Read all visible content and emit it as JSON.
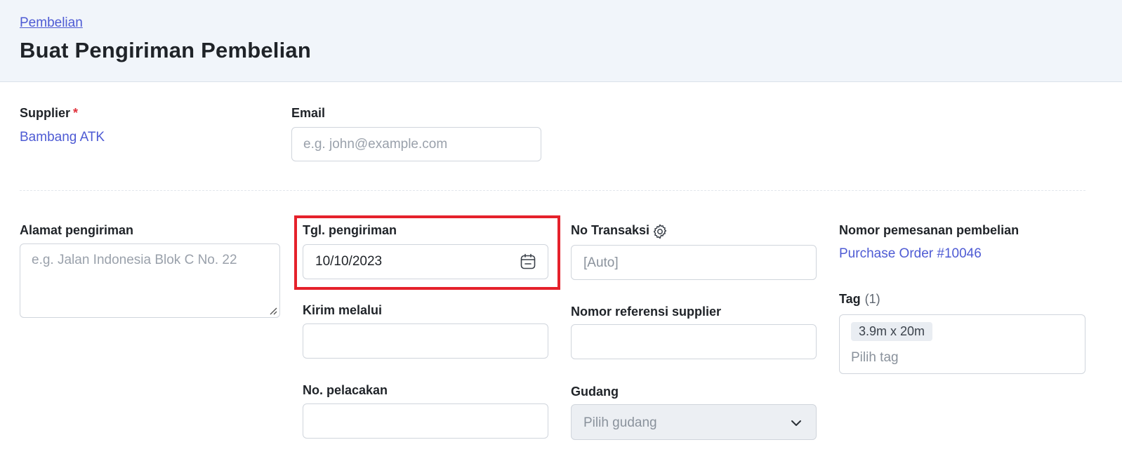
{
  "header": {
    "breadcrumb": "Pembelian",
    "title": "Buat Pengiriman Pembelian"
  },
  "supplier": {
    "label": "Supplier",
    "required_mark": "*",
    "value": "Bambang ATK"
  },
  "email": {
    "label": "Email",
    "placeholder": "e.g. john@example.com",
    "value": ""
  },
  "shipping_address": {
    "label": "Alamat pengiriman",
    "placeholder": "e.g. Jalan Indonesia Blok C No. 22",
    "value": ""
  },
  "shipping_date": {
    "label": "Tgl. pengiriman",
    "value": "10/10/2023",
    "icon": "calendar-icon"
  },
  "transaction_no": {
    "label": "No Transaksi",
    "icon": "gear-icon",
    "value": "[Auto]"
  },
  "purchase_order": {
    "label": "Nomor pemesanan pembelian",
    "value": "Purchase Order #10046"
  },
  "ship_via": {
    "label": "Kirim melalui",
    "value": ""
  },
  "supplier_ref": {
    "label": "Nomor referensi supplier",
    "value": ""
  },
  "tag": {
    "label": "Tag",
    "count": "(1)",
    "chips": [
      "3.9m x 20m"
    ],
    "placeholder": "Pilih tag"
  },
  "tracking_no": {
    "label": "No. pelacakan",
    "value": ""
  },
  "warehouse": {
    "label": "Gudang",
    "placeholder": "Pilih gudang",
    "icon": "chevron-down-icon"
  },
  "colors": {
    "accent": "#4e5bd4",
    "highlight": "#e5212b",
    "header_bg": "#f1f5fa"
  }
}
